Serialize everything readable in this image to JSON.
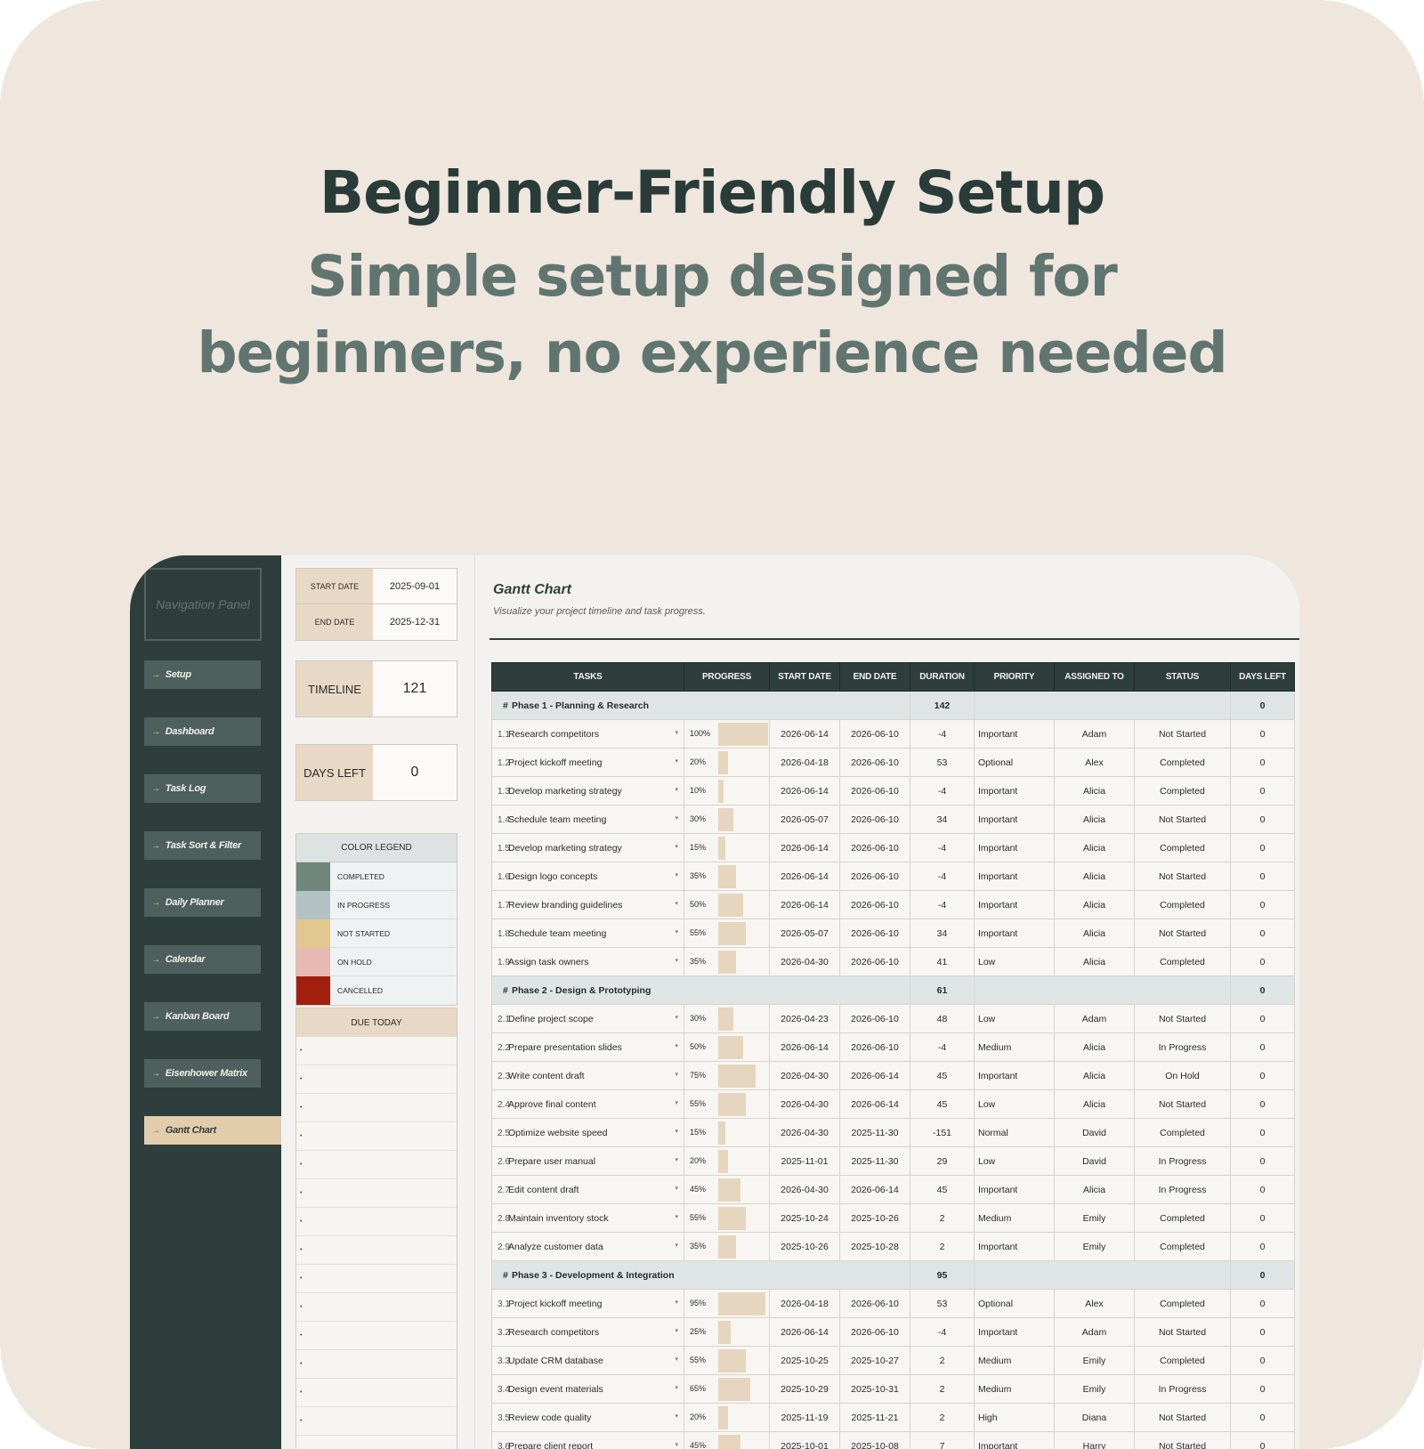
{
  "header": {
    "title": "Beginner-Friendly Setup",
    "subtitle_line1": "Simple setup designed for",
    "subtitle_line2": "beginners, no experience needed"
  },
  "nav": {
    "title": "Navigation Panel",
    "items": [
      {
        "label": "Setup"
      },
      {
        "label": "Dashboard"
      },
      {
        "label": "Task Log"
      },
      {
        "label": "Task Sort & Filter"
      },
      {
        "label": "Daily Planner"
      },
      {
        "label": "Calendar"
      },
      {
        "label": "Kanban Board"
      },
      {
        "label": "Eisenhower Matrix"
      },
      {
        "label": "Gantt Chart",
        "active": true
      }
    ]
  },
  "dates": {
    "start_label": "START DATE",
    "start_value": "2025-09-01",
    "end_label": "END DATE",
    "end_value": "2025-12-31"
  },
  "timeline": {
    "label": "TIMELINE",
    "value": "121"
  },
  "days_left": {
    "label": "DAYS LEFT",
    "value": "0"
  },
  "legend": {
    "title": "COLOR LEGEND",
    "items": [
      {
        "label": "COMPLETED",
        "color": "#6f877b"
      },
      {
        "label": "IN PROGRESS",
        "color": "#b3c2c5"
      },
      {
        "label": "NOT STARTED",
        "color": "#e2c790"
      },
      {
        "label": "ON HOLD",
        "color": "#e8b8b2"
      },
      {
        "label": "CANCELLED",
        "color": "#a11f0f"
      }
    ]
  },
  "due_today": {
    "title": "DUE TODAY"
  },
  "gantt": {
    "title": "Gantt Chart",
    "subtitle": "Visualize your project timeline and task progress.",
    "columns": [
      "TASKS",
      "PROGRESS",
      "START DATE",
      "END DATE",
      "DURATION",
      "PRIORITY",
      "ASSIGNED TO",
      "STATUS",
      "DAYS LEFT"
    ],
    "phases": [
      {
        "hash": "#",
        "name": "Phase 1 - Planning & Research",
        "duration": "142",
        "days_left": "0",
        "tasks": [
          {
            "num": "1.1",
            "name": "Research competitors",
            "progress_label": "100%",
            "progress": 1.0,
            "start": "2026-06-14",
            "end": "2026-06-10",
            "duration": "-4",
            "priority": "Important",
            "assigned": "Adam",
            "status": "Not Started",
            "days_left": "0"
          },
          {
            "num": "1.2",
            "name": "Project kickoff meeting",
            "progress_label": "20%",
            "progress": 0.2,
            "start": "2026-04-18",
            "end": "2026-06-10",
            "duration": "53",
            "priority": "Optional",
            "assigned": "Alex",
            "status": "Completed",
            "days_left": "0"
          },
          {
            "num": "1.3",
            "name": "Develop marketing strategy",
            "progress_label": "10%",
            "progress": 0.1,
            "start": "2026-06-14",
            "end": "2026-06-10",
            "duration": "-4",
            "priority": "Important",
            "assigned": "Alicia",
            "status": "Completed",
            "days_left": "0"
          },
          {
            "num": "1.4",
            "name": "Schedule team meeting",
            "progress_label": "30%",
            "progress": 0.3,
            "start": "2026-05-07",
            "end": "2026-06-10",
            "duration": "34",
            "priority": "Important",
            "assigned": "Alicia",
            "status": "Not Started",
            "days_left": "0"
          },
          {
            "num": "1.5",
            "name": "Develop marketing strategy",
            "progress_label": "15%",
            "progress": 0.15,
            "start": "2026-06-14",
            "end": "2026-06-10",
            "duration": "-4",
            "priority": "Important",
            "assigned": "Alicia",
            "status": "Completed",
            "days_left": "0"
          },
          {
            "num": "1.6",
            "name": "Design logo concepts",
            "progress_label": "35%",
            "progress": 0.35,
            "start": "2026-06-14",
            "end": "2026-06-10",
            "duration": "-4",
            "priority": "Important",
            "assigned": "Alicia",
            "status": "Not Started",
            "days_left": "0"
          },
          {
            "num": "1.7",
            "name": "Review branding guidelines",
            "progress_label": "50%",
            "progress": 0.5,
            "start": "2026-06-14",
            "end": "2026-06-10",
            "duration": "-4",
            "priority": "Important",
            "assigned": "Alicia",
            "status": "Completed",
            "days_left": "0"
          },
          {
            "num": "1.8",
            "name": "Schedule team meeting",
            "progress_label": "55%",
            "progress": 0.55,
            "start": "2026-05-07",
            "end": "2026-06-10",
            "duration": "34",
            "priority": "Important",
            "assigned": "Alicia",
            "status": "Not Started",
            "days_left": "0"
          },
          {
            "num": "1.9",
            "name": "Assign task owners",
            "progress_label": "35%",
            "progress": 0.35,
            "start": "2026-04-30",
            "end": "2026-06-10",
            "duration": "41",
            "priority": "Low",
            "assigned": "Alicia",
            "status": "Completed",
            "days_left": "0"
          }
        ]
      },
      {
        "hash": "#",
        "name": "Phase 2 - Design & Prototyping",
        "duration": "61",
        "days_left": "0",
        "tasks": [
          {
            "num": "2.1",
            "name": "Define project scope",
            "progress_label": "30%",
            "progress": 0.3,
            "start": "2026-04-23",
            "end": "2026-06-10",
            "duration": "48",
            "priority": "Low",
            "assigned": "Adam",
            "status": "Not Started",
            "days_left": "0"
          },
          {
            "num": "2.2",
            "name": "Prepare presentation slides",
            "progress_label": "50%",
            "progress": 0.5,
            "start": "2026-06-14",
            "end": "2026-06-10",
            "duration": "-4",
            "priority": "Medium",
            "assigned": "Alicia",
            "status": "In Progress",
            "days_left": "0"
          },
          {
            "num": "2.3",
            "name": "Write content draft",
            "progress_label": "75%",
            "progress": 0.75,
            "start": "2026-04-30",
            "end": "2026-06-14",
            "duration": "45",
            "priority": "Important",
            "assigned": "Alicia",
            "status": "On Hold",
            "days_left": "0"
          },
          {
            "num": "2.4",
            "name": "Approve final content",
            "progress_label": "55%",
            "progress": 0.55,
            "start": "2026-04-30",
            "end": "2026-06-14",
            "duration": "45",
            "priority": "Low",
            "assigned": "Alicia",
            "status": "Not Started",
            "days_left": "0"
          },
          {
            "num": "2.5",
            "name": "Optimize website speed",
            "progress_label": "15%",
            "progress": 0.15,
            "start": "2026-04-30",
            "end": "2025-11-30",
            "duration": "-151",
            "priority": "Normal",
            "assigned": "David",
            "status": "Completed",
            "days_left": "0"
          },
          {
            "num": "2.6",
            "name": "Prepare user manual",
            "progress_label": "20%",
            "progress": 0.2,
            "start": "2025-11-01",
            "end": "2025-11-30",
            "duration": "29",
            "priority": "Low",
            "assigned": "David",
            "status": "In Progress",
            "days_left": "0"
          },
          {
            "num": "2.7",
            "name": "Edit content draft",
            "progress_label": "45%",
            "progress": 0.45,
            "start": "2026-04-30",
            "end": "2026-06-14",
            "duration": "45",
            "priority": "Important",
            "assigned": "Alicia",
            "status": "In Progress",
            "days_left": "0"
          },
          {
            "num": "2.8",
            "name": "Maintain inventory stock",
            "progress_label": "55%",
            "progress": 0.55,
            "start": "2025-10-24",
            "end": "2025-10-26",
            "duration": "2",
            "priority": "Medium",
            "assigned": "Emily",
            "status": "Completed",
            "days_left": "0"
          },
          {
            "num": "2.9",
            "name": "Analyze customer data",
            "progress_label": "35%",
            "progress": 0.35,
            "start": "2025-10-26",
            "end": "2025-10-28",
            "duration": "2",
            "priority": "Important",
            "assigned": "Emily",
            "status": "Completed",
            "days_left": "0"
          }
        ]
      },
      {
        "hash": "#",
        "name": "Phase 3 - Development & Integration",
        "duration": "95",
        "days_left": "0",
        "tasks": [
          {
            "num": "3.1",
            "name": "Project kickoff meeting",
            "progress_label": "95%",
            "progress": 0.95,
            "start": "2026-04-18",
            "end": "2026-06-10",
            "duration": "53",
            "priority": "Optional",
            "assigned": "Alex",
            "status": "Completed",
            "days_left": "0"
          },
          {
            "num": "3.2",
            "name": "Research competitors",
            "progress_label": "25%",
            "progress": 0.25,
            "start": "2026-06-14",
            "end": "2026-06-10",
            "duration": "-4",
            "priority": "Important",
            "assigned": "Adam",
            "status": "Not Started",
            "days_left": "0"
          },
          {
            "num": "3.3",
            "name": "Update CRM database",
            "progress_label": "55%",
            "progress": 0.55,
            "start": "2025-10-25",
            "end": "2025-10-27",
            "duration": "2",
            "priority": "Medium",
            "assigned": "Emily",
            "status": "Completed",
            "days_left": "0"
          },
          {
            "num": "3.4",
            "name": "Design event materials",
            "progress_label": "65%",
            "progress": 0.65,
            "start": "2025-10-29",
            "end": "2025-10-31",
            "duration": "2",
            "priority": "Medium",
            "assigned": "Emily",
            "status": "In Progress",
            "days_left": "0"
          },
          {
            "num": "3.5",
            "name": "Review code quality",
            "progress_label": "20%",
            "progress": 0.2,
            "start": "2025-11-19",
            "end": "2025-11-21",
            "duration": "2",
            "priority": "High",
            "assigned": "Diana",
            "status": "Not Started",
            "days_left": "0"
          },
          {
            "num": "3.6",
            "name": "Prepare client report",
            "progress_label": "45%",
            "progress": 0.45,
            "start": "2025-10-01",
            "end": "2025-10-08",
            "duration": "7",
            "priority": "Important",
            "assigned": "Harry",
            "status": "Not Started",
            "days_left": "0"
          }
        ]
      }
    ]
  }
}
